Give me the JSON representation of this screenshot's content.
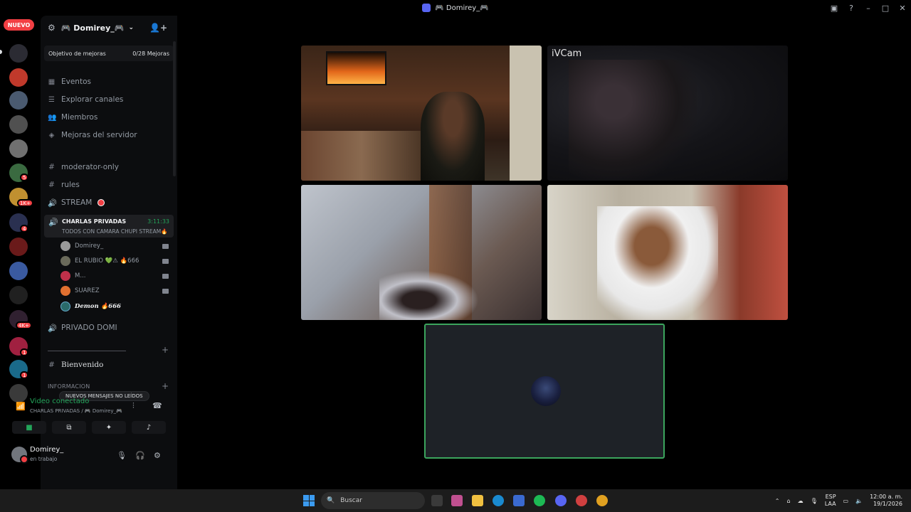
{
  "window": {
    "title": "🎮 Domirey_🎮"
  },
  "rail": {
    "new_label": "NUEVO",
    "badges": [
      "5",
      "1K+",
      "4",
      "4K+",
      "1",
      "1"
    ]
  },
  "server": {
    "name": "🎮 Domirey_🎮",
    "boost_label": "Objetivo de mejoras",
    "boost_count": "0/28 Mejoras",
    "nav": [
      "Eventos",
      "Explorar canales",
      "Miembros",
      "Mejoras del servidor"
    ],
    "channels": {
      "moderator": "moderator-only",
      "rules": "rules",
      "stream": "STREAM"
    },
    "voice_channel": {
      "name": "CHARLAS PRIVADAS",
      "time": "3:11:33",
      "status": "TODOS CON CAMARA CHUPI STREAM🔥",
      "users": [
        "Domirey_",
        "EL RUBIO 💚⚠ 🔥666",
        "M...",
        "SUAREZ",
        "Demon 🔥666"
      ]
    },
    "private_channel": "PRIVADO DOMI",
    "welcome_channel": "Bienvenido",
    "info_category": "INFORMACION",
    "unread_pill": "NUEVOS MENSAJES NO LEÍDOS"
  },
  "voice_panel": {
    "title": "Video conectado",
    "subtitle": "CHARLAS PRIVADAS / 🎮 Domirey_🎮"
  },
  "user": {
    "name": "Domirey_",
    "status": "en trabajo"
  },
  "stage": {
    "tile2_label": "iVCam"
  },
  "taskbar": {
    "search_placeholder": "Buscar",
    "lang": "ESP",
    "lang2": "LAA",
    "time": "12:00 a. m.",
    "date": "19/1/2026"
  }
}
